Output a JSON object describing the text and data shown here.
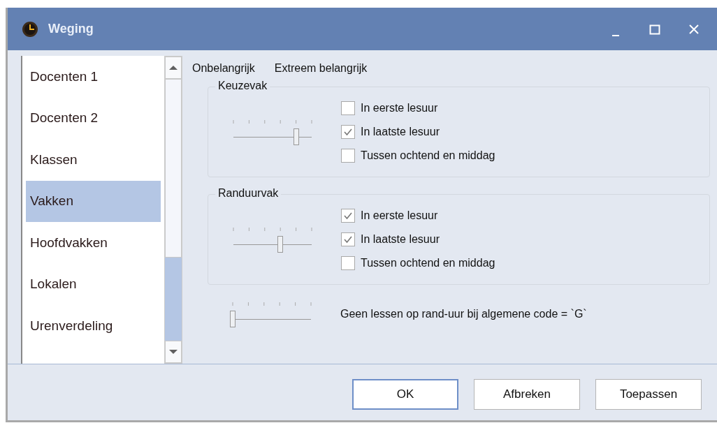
{
  "window": {
    "title": "Weging"
  },
  "sidebar": {
    "items": [
      {
        "label": "Docenten 1",
        "selected": false
      },
      {
        "label": "Docenten 2",
        "selected": false
      },
      {
        "label": "Klassen",
        "selected": false
      },
      {
        "label": "Vakken",
        "selected": true
      },
      {
        "label": "Hoofdvakken",
        "selected": false
      },
      {
        "label": "Lokalen",
        "selected": false
      },
      {
        "label": "Urenverdeling",
        "selected": false
      }
    ]
  },
  "scale": {
    "low": "Onbelangrijk",
    "high": "Extreem belangrijk"
  },
  "groups": [
    {
      "title": "Keuzevak",
      "level": 0.8,
      "options": [
        {
          "label": "In eerste lesuur",
          "checked": false
        },
        {
          "label": "In laatste lesuur",
          "checked": true
        },
        {
          "label": "Tussen ochtend en middag",
          "checked": false
        }
      ]
    },
    {
      "title": "Randuurvak",
      "level": 0.6,
      "options": [
        {
          "label": "In eerste lesuur",
          "checked": true
        },
        {
          "label": "In laatste lesuur",
          "checked": true
        },
        {
          "label": "Tussen ochtend en middag",
          "checked": false
        }
      ]
    }
  ],
  "general": {
    "level": 0,
    "label": "Geen lessen op rand-uur bij algemene code = `G`"
  },
  "buttons": [
    {
      "label": "OK",
      "selected": true
    },
    {
      "label": "Afbreken",
      "selected": false
    },
    {
      "label": "Toepassen",
      "selected": false
    }
  ]
}
